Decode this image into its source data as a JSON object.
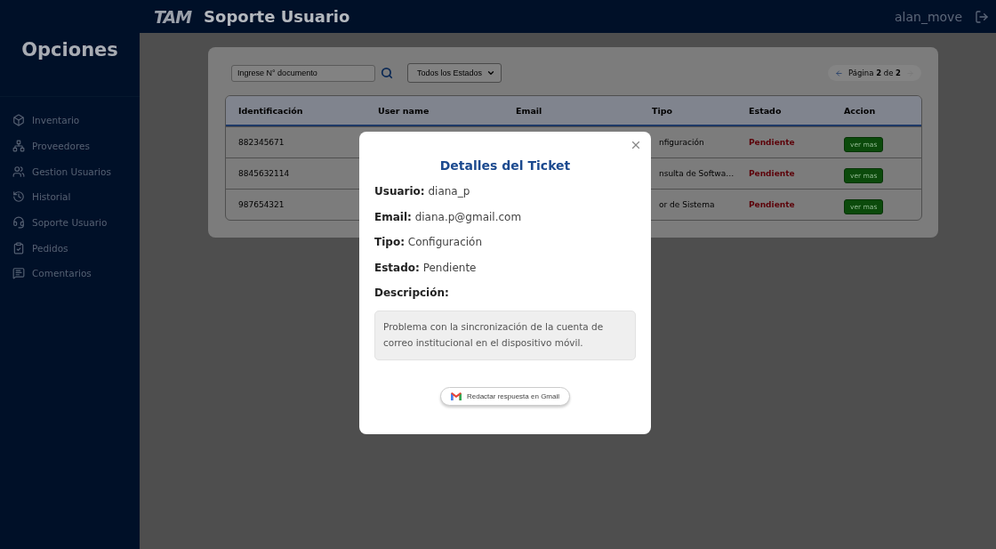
{
  "header": {
    "logo": "TAM",
    "title": "Soporte Usuario",
    "user": "alan_move"
  },
  "sidebar": {
    "title": "Opciones",
    "items": [
      {
        "label": "Inventario"
      },
      {
        "label": "Proveedores"
      },
      {
        "label": "Gestion Usuarios"
      },
      {
        "label": "Historial"
      },
      {
        "label": "Soporte Usuario"
      },
      {
        "label": "Pedidos"
      },
      {
        "label": "Comentarios"
      }
    ]
  },
  "filters": {
    "search_placeholder": "Ingrese N° documento",
    "status_select": "Todos los Estados"
  },
  "pagination": {
    "text": "Página **2** de **2**"
  },
  "table": {
    "columns": [
      "Identificación",
      "User name",
      "Email",
      "Tipo",
      "Estado",
      "Accion"
    ],
    "rows": [
      {
        "id": "882345671",
        "tipo": "nfiguración",
        "estado": "Pendiente",
        "action": "ver mas"
      },
      {
        "id": "8845632114",
        "tipo": "nsulta de Softwa…",
        "estado": "Pendiente",
        "action": "ver mas"
      },
      {
        "id": "987654321",
        "tipo": "or de Sistema",
        "estado": "Pendiente",
        "action": "ver mas"
      }
    ]
  },
  "modal": {
    "title": "Detalles del Ticket",
    "fields": [
      {
        "label": "Usuario:",
        "value": "diana_p"
      },
      {
        "label": "Email:",
        "value": "diana.p@gmail.com"
      },
      {
        "label": "Tipo:",
        "value": "Configuración"
      },
      {
        "label": "Estado:",
        "value": "Pendiente"
      }
    ],
    "description_label": "Descripción:",
    "description": "Problema con la sincronización de la cuenta de correo institucional en el dispositivo móvil.",
    "button": "Redactar respuesta en Gmail"
  }
}
